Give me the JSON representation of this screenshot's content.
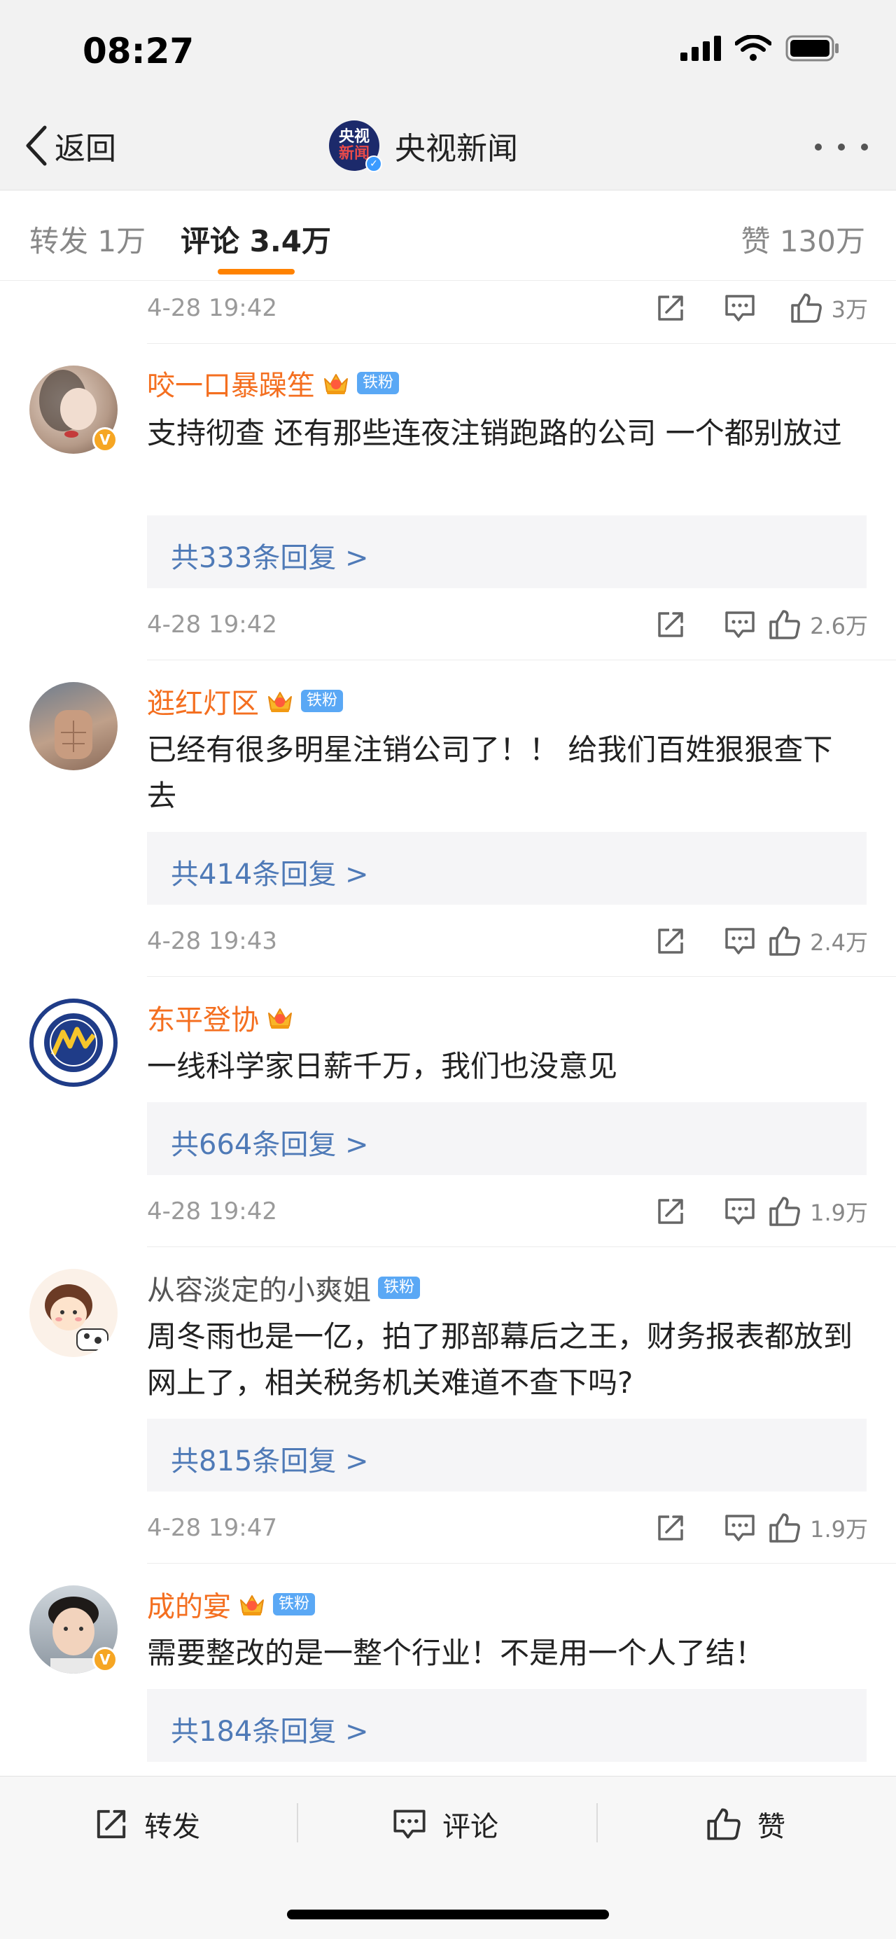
{
  "status_bar": {
    "time": "08:27"
  },
  "nav": {
    "back_label": "返回",
    "account_name": "央视新闻",
    "logo_line1": "央视",
    "logo_line2": "新闻"
  },
  "tabs": {
    "repost": "转发 1万",
    "comments": "评论 3.4万",
    "likes": "赞 130万"
  },
  "top_comment_meta": {
    "time": "4-28 19:42",
    "likes": "3万"
  },
  "comments": [
    {
      "username": "咬一口暴躁笙",
      "crown_level": "5",
      "fan_badge": "铁粉",
      "text": "支持彻查 还有那些连夜注销跑路的公司 一个都别放过",
      "replies": "共333条回复 >",
      "time": "4-28 19:42",
      "likes": "2.6万",
      "avatar_badge": "V"
    },
    {
      "username": "逛红灯区",
      "crown_level": "4",
      "fan_badge": "铁粉",
      "text": "已经有很多明星注销公司了！！ 给我们百姓狠狠查下去",
      "replies": "共414条回复 >",
      "time": "4-28 19:43",
      "likes": "2.4万"
    },
    {
      "username": "东平登协",
      "crown_level": "6",
      "text": "一线科学家日薪千万，我们也没意见",
      "replies": "共664条回复 >",
      "time": "4-28 19:42",
      "likes": "1.9万"
    },
    {
      "username": "从容淡定的小爽姐",
      "fan_badge": "铁粉",
      "text": "周冬雨也是一亿，拍了那部幕后之王，财务报表都放到网上了，相关税务机关难道不查下吗?",
      "replies": "共815条回复 >",
      "time": "4-28 19:47",
      "likes": "1.9万"
    },
    {
      "username": "成的宴",
      "crown_level": "5",
      "fan_badge": "铁粉",
      "text": "需要整改的是一整个行业！不是用一个人了结！",
      "replies": "共184条回复 >",
      "avatar_badge": "V"
    }
  ],
  "bottom_bar": {
    "repost_label": "转发",
    "comment_label": "评论",
    "like_label": "赞"
  },
  "colors": {
    "accent": "#ff8200",
    "username": "#f46f20",
    "reply_link": "#4f7ab7",
    "fan_badge": "#5aa8f5"
  },
  "icons": [
    "signal-icon",
    "wifi-icon",
    "battery-icon",
    "back-chevron-icon",
    "more-icon",
    "share-icon",
    "comment-icon",
    "like-icon",
    "crown-icon",
    "verified-icon"
  ]
}
